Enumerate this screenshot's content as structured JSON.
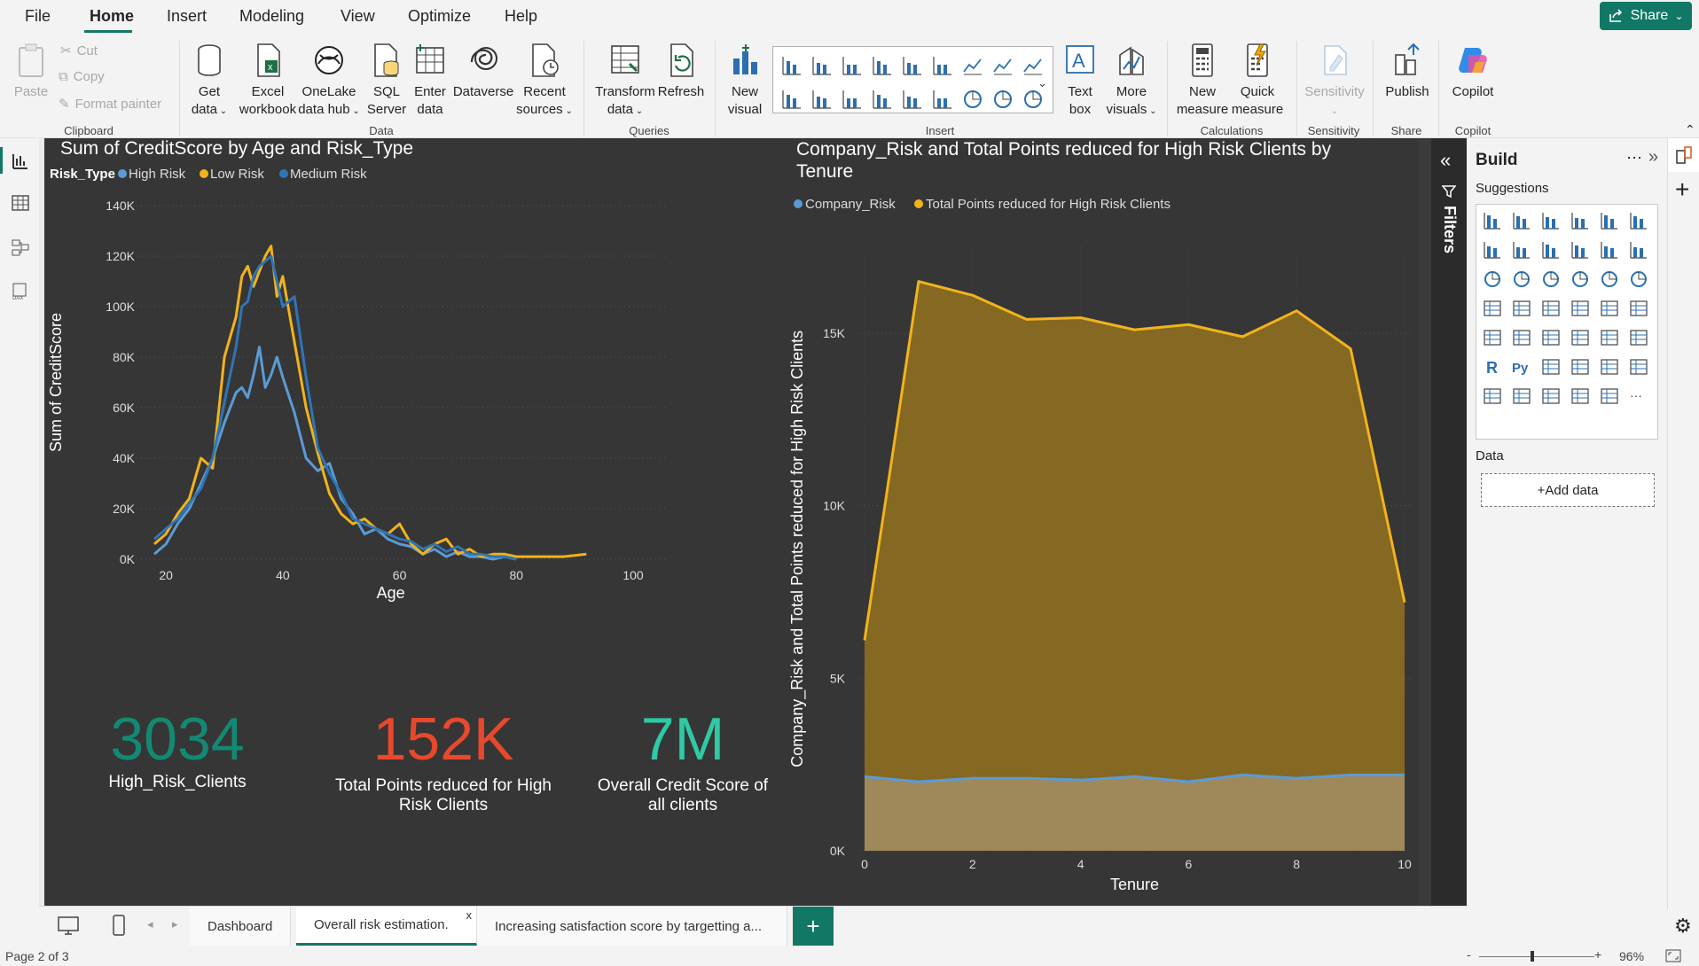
{
  "menu": {
    "file": "File",
    "home": "Home",
    "insert": "Insert",
    "modeling": "Modeling",
    "view": "View",
    "optimize": "Optimize",
    "help": "Help",
    "share": "Share"
  },
  "ribbon": {
    "paste": "Paste",
    "cut": "Cut",
    "copy": "Copy",
    "format_painter": "Format painter",
    "get_data": [
      "Get",
      "data"
    ],
    "excel": [
      "Excel",
      "workbook"
    ],
    "onelake": [
      "OneLake",
      "data hub"
    ],
    "sql": [
      "SQL",
      "Server"
    ],
    "enter_data": [
      "Enter",
      "data"
    ],
    "dataverse": "Dataverse",
    "recent": [
      "Recent",
      "sources"
    ],
    "transform": [
      "Transform",
      "data"
    ],
    "refresh": "Refresh",
    "new_visual": [
      "New",
      "visual"
    ],
    "text_box": [
      "Text",
      "box"
    ],
    "more_visuals": [
      "More",
      "visuals"
    ],
    "new_measure": [
      "New",
      "measure"
    ],
    "quick_measure": [
      "Quick",
      "measure"
    ],
    "sensitivity": "Sensitivity",
    "publish": "Publish",
    "copilot": "Copilot",
    "groups": {
      "clipboard": "Clipboard",
      "data": "Data",
      "queries": "Queries",
      "insert": "Insert",
      "calculations": "Calculations",
      "sensitivity": "Sensitivity",
      "share": "Share",
      "copilot": "Copilot"
    }
  },
  "line_chart": {
    "title": "Sum of CreditScore by Age and Risk_Type",
    "legend_title": "Risk_Type",
    "ylabel": "Sum of CreditScore",
    "xlabel": "Age"
  },
  "area_chart": {
    "title_line1": "Company_Risk and Total Points reduced for High Risk Clients by",
    "title_line2": "Tenure",
    "ylabel": "Company_Risk and Total Points reduced for High Risk Clients",
    "xlabel": "Tenure"
  },
  "cards": [
    {
      "value": "3034",
      "label1": "High_Risk_Clients",
      "label2": "",
      "color": "#128a73"
    },
    {
      "value": "152K",
      "label1": "Total Points reduced for High",
      "label2": "Risk Clients",
      "color": "#e8482b"
    },
    {
      "value": "7M",
      "label1": "Overall Credit Score of",
      "label2": "all clients",
      "color": "#2ec9a5"
    }
  ],
  "chart_data": [
    {
      "type": "line",
      "title": "Sum of CreditScore by Age and Risk_Type",
      "xlabel": "Age",
      "ylabel": "Sum of CreditScore",
      "xlim": [
        18,
        100
      ],
      "ylim": [
        0,
        140000
      ],
      "xticks": [
        "20",
        "40",
        "60",
        "80",
        "100"
      ],
      "yticks": [
        "0K",
        "20K",
        "40K",
        "60K",
        "80K",
        "100K",
        "120K",
        "140K"
      ],
      "legend": "top-left",
      "grid": true,
      "series": [
        {
          "name": "High Risk",
          "color": "#5b9bd5",
          "x": [
            18,
            20,
            22,
            24,
            26,
            28,
            30,
            32,
            33,
            34,
            35,
            36,
            37,
            38,
            39,
            40,
            42,
            44,
            46,
            48,
            50,
            52,
            54,
            56,
            58,
            60,
            62,
            64,
            66,
            68,
            70,
            72,
            74,
            76,
            78,
            80
          ],
          "values": [
            2000,
            6000,
            14000,
            20000,
            30000,
            40000,
            54000,
            66000,
            68000,
            64000,
            73000,
            84000,
            68000,
            73000,
            80000,
            72000,
            58000,
            40000,
            35000,
            38000,
            24000,
            18000,
            10000,
            12000,
            8000,
            6000,
            5000,
            2000,
            4000,
            1000,
            3000,
            1000,
            1000,
            0,
            1000,
            0
          ]
        },
        {
          "name": "Low Risk",
          "color": "#f2b31b",
          "x": [
            18,
            20,
            22,
            24,
            26,
            28,
            30,
            32,
            33,
            34,
            35,
            36,
            37,
            38,
            39,
            40,
            42,
            44,
            46,
            48,
            50,
            52,
            54,
            56,
            58,
            60,
            62,
            64,
            66,
            68,
            70,
            72,
            74,
            76,
            78,
            80,
            82,
            84,
            86,
            88,
            90,
            92
          ],
          "values": [
            6000,
            10000,
            18000,
            24000,
            40000,
            36000,
            80000,
            96000,
            112000,
            116000,
            108000,
            114000,
            120000,
            124000,
            104000,
            112000,
            86000,
            60000,
            42000,
            26000,
            18000,
            14000,
            16000,
            12000,
            10000,
            14000,
            6000,
            2000,
            6000,
            8000,
            2000,
            4000,
            1000,
            2000,
            2000,
            1000,
            1000,
            1000,
            1000,
            1000,
            1500,
            2000
          ]
        },
        {
          "name": "Medium Risk",
          "color": "#2f75b5",
          "x": [
            18,
            20,
            22,
            24,
            26,
            28,
            30,
            32,
            33,
            34,
            35,
            36,
            37,
            38,
            39,
            40,
            42,
            44,
            46,
            48,
            50,
            52,
            54,
            56,
            58,
            60,
            62,
            64,
            66,
            68,
            70,
            72,
            74,
            76,
            78,
            80
          ],
          "values": [
            8000,
            12000,
            16000,
            22000,
            28000,
            40000,
            62000,
            84000,
            100000,
            102000,
            112000,
            116000,
            118000,
            120000,
            110000,
            100000,
            104000,
            72000,
            44000,
            34000,
            26000,
            16000,
            14000,
            12000,
            10000,
            8000,
            7000,
            4000,
            6000,
            3000,
            5000,
            2000,
            2000,
            1000,
            1000,
            0
          ]
        }
      ]
    },
    {
      "type": "area",
      "title": "Company_Risk and Total Points reduced for High Risk Clients by Tenure",
      "xlabel": "Tenure",
      "ylabel": "Company_Risk and Total Points reduced for High Risk Clients",
      "xlim": [
        0,
        10
      ],
      "ylim": [
        0,
        18000
      ],
      "xticks": [
        "0",
        "2",
        "4",
        "6",
        "8",
        "10"
      ],
      "yticks": [
        "0K",
        "5K",
        "10K",
        "15K"
      ],
      "legend": "top-left",
      "grid": true,
      "x": [
        0,
        1,
        2,
        3,
        4,
        5,
        6,
        7,
        8,
        9,
        10
      ],
      "series": [
        {
          "name": "Company_Risk",
          "color": "#5b9bd5",
          "values": [
            2150,
            2000,
            2100,
            2100,
            2050,
            2150,
            2000,
            2200,
            2100,
            2200,
            2200
          ]
        },
        {
          "name": "Total Points reduced for High Risk Clients",
          "color": "#f2b31b",
          "values": [
            6100,
            16500,
            16100,
            15400,
            15450,
            15100,
            15250,
            14900,
            15650,
            14550,
            7200
          ]
        }
      ]
    }
  ],
  "filters_label": "Filters",
  "build": {
    "title": "Build",
    "suggestions": "Suggestions",
    "data": "Data",
    "add_data": "+Add data"
  },
  "tabs": [
    "Dashboard",
    "Overall risk estimation.",
    "Increasing satisfaction score by targetting a..."
  ],
  "tab_close": "x",
  "status": {
    "page": "Page 2 of 3",
    "zoom": "96%",
    "minus": "-",
    "plus": "+"
  }
}
